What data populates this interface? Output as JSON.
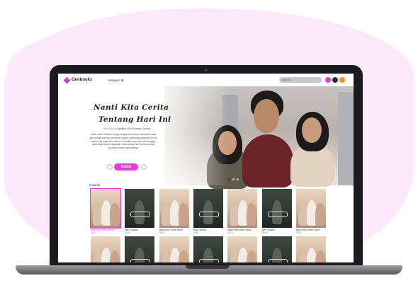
{
  "navbar": {
    "brand": "Genbookz",
    "category_label": "Kategori",
    "search_placeholder": "search...",
    "icons": [
      "bell-icon",
      "profile-icon",
      "user-avatar"
    ]
  },
  "hero": {
    "title_line1": "Nanti Kita Cerita",
    "title_line2": "Tentang Hari Ini",
    "rating": "96% Cocok",
    "meta_rest": "Agustus 2019 Drama Comedi",
    "synopsis": "Kisah anak SANAGA yang sangat suka mencontek pada saat jam pelajar pak ejo dan suka makan pada saat pelajaran bu ria namun dia juga suka minum, ini kaktim gue hire dari sanggal suka kabur pada saat jalan sehat setiap hari dan keceknya kosenya macet lagi kadenya",
    "read_button": "BACA",
    "slider_dots": 3
  },
  "section": {
    "label": "Komedi"
  },
  "grid": {
    "row1": [
      {
        "title": "Nanti Kita Cerita Tenta...",
        "year": "2020",
        "style": "A",
        "selected": true
      },
      {
        "title": "Nim Thewok",
        "year": "2020",
        "style": "B",
        "selected": false
      },
      {
        "title": "Nanti Kita Cerita Tenta...",
        "year": "2020",
        "style": "A",
        "selected": false
      },
      {
        "title": "Nim Thewok",
        "year": "2020",
        "style": "B",
        "selected": false
      },
      {
        "title": "Nanti Kita Cerita Tenta...",
        "year": "2019",
        "style": "A",
        "selected": false
      },
      {
        "title": "Nim Thewok",
        "year": "2019",
        "style": "B",
        "selected": false
      },
      {
        "title": "Nanti Kita Cerita Tenta...",
        "year": "2020",
        "style": "A",
        "selected": false
      }
    ],
    "row2": [
      {
        "style": "A"
      },
      {
        "style": "B"
      },
      {
        "style": "A"
      },
      {
        "style": "B"
      },
      {
        "style": "A"
      },
      {
        "style": "B"
      },
      {
        "style": "A"
      }
    ]
  },
  "colors": {
    "accent": "#e33fd6",
    "blob": "#fce8fa",
    "laptop": "#1c1c1e"
  }
}
